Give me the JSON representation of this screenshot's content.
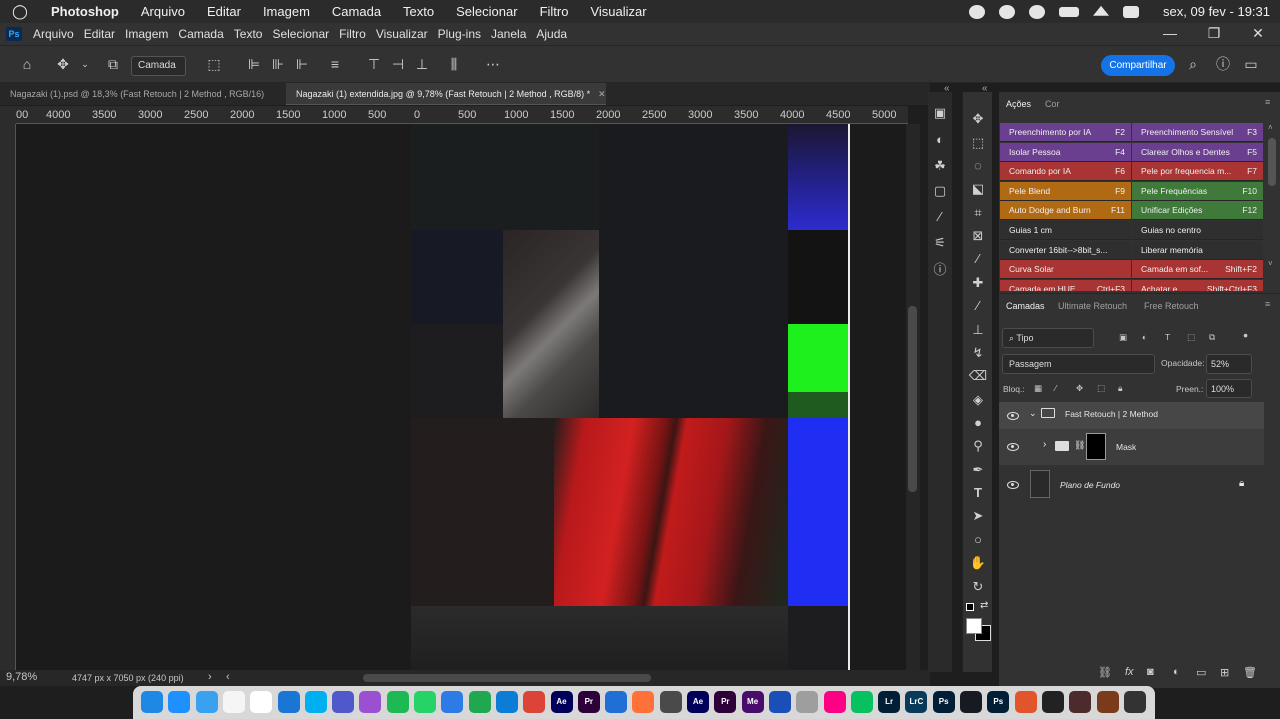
{
  "mac_menubar": {
    "app_name": "Photoshop",
    "items": [
      "Arquivo",
      "Editar",
      "Imagem",
      "Camada",
      "Texto",
      "Selecionar",
      "Filtro",
      "Visualizar"
    ],
    "clock": "sex, 09 fev - 19:31"
  },
  "ps_menubar": {
    "logo": "Ps",
    "items": [
      "Arquivo",
      "Editar",
      "Imagem",
      "Camada",
      "Texto",
      "Selecionar",
      "Filtro",
      "Visualizar",
      "Plug-ins",
      "Janela",
      "Ajuda"
    ],
    "window_controls": [
      "—",
      "❐",
      "✕"
    ]
  },
  "options_bar": {
    "target_select": "Camada",
    "share_button": "Compartilhar"
  },
  "tabs": [
    {
      "label": "Nagazaki (1).psd @ 18,3% (Fast Retouch | 2 Method , RGB/16) *",
      "active": false
    },
    {
      "label": "Nagazaki (1) extendida.jpg @ 9,78% (Fast Retouch | 2 Method , RGB/8) *",
      "active": true
    }
  ],
  "ruler_labels": [
    "00",
    "4000",
    "3500",
    "3000",
    "2500",
    "2000",
    "1500",
    "1000",
    "500",
    "0",
    "500",
    "1000",
    "1500",
    "2000",
    "2500",
    "3000",
    "3500",
    "4000",
    "4500",
    "5000"
  ],
  "status_bar": {
    "zoom": "9,78%",
    "dimensions": "4747 px x 7050 px (240 ppi)"
  },
  "actions_panel": {
    "tabs": [
      "Ações",
      "Cor"
    ],
    "rows": [
      {
        "left": "Preenchimento por IA",
        "left_key": "F2",
        "right": "Preenchimento Sensível",
        "right_key": "F3",
        "color": "#6a3f8f"
      },
      {
        "left": "Isolar Pessoa",
        "left_key": "F4",
        "right": "Clarear Olhos e Dentes",
        "right_key": "F5",
        "color": "#6a3f8f"
      },
      {
        "left": "Comando por IA",
        "left_key": "F6",
        "right": "Pele por frequencia m...",
        "right_key": "F7",
        "color": "#a83434"
      },
      {
        "left": "Pele Blend",
        "left_key": "F9",
        "right": "Pele Frequências",
        "right_key": "F10",
        "color": "#b06a14"
      },
      {
        "left": "Auto Dodge and Burn",
        "left_key": "F11",
        "right": "Unificar Edições",
        "right_key": "F12",
        "color": "#b06a14"
      },
      {
        "left": "Guias 1 cm",
        "left_key": "",
        "right": "Guias no centro",
        "right_key": "",
        "color": "#2f2f2f"
      },
      {
        "left": "Converter 16bit-->8bit_s...",
        "left_key": "",
        "right": "Liberar memória",
        "right_key": "",
        "color": "#2f2f2f"
      },
      {
        "left": "Curva Solar",
        "left_key": "",
        "right": "Camada em sof...",
        "right_key": "Shift+F2",
        "color": "#a83434"
      },
      {
        "left": "Camada em HUE",
        "left_key": "Ctrl+F3",
        "right": "Achatar e...",
        "right_key": "Shift+Ctrl+F3",
        "color": "#a83434"
      }
    ],
    "row5_right_color": "#3f7a3a",
    "row4_right_color": "#3f7a3a"
  },
  "layers_panel": {
    "tabs": [
      "Camadas",
      "Ultimate Retouch",
      "Free Retouch"
    ],
    "filter": "Tipo",
    "blend_mode": "Passagem",
    "opacity_label": "Opacidade:",
    "opacity_value": "52%",
    "lock_label": "Bloq.:",
    "fill_label": "Preen.:",
    "fill_value": "100%",
    "layers": [
      {
        "name": "Fast Retouch | 2 Method",
        "type": "group"
      },
      {
        "name": "Mask",
        "type": "group-child"
      },
      {
        "name": "Plano de Fundo",
        "type": "background"
      }
    ]
  },
  "colors": {
    "accent": "#1473e6",
    "canvas_red": "#c71a1a",
    "canvas_green": "#1ef01e",
    "canvas_blue": "#1f2ef2"
  },
  "dock": {
    "apps": [
      "Finder",
      "Safari",
      "iCloud",
      "Notes",
      "Calendar",
      "App Store",
      "Skype",
      "Teams",
      "Podcasts",
      "Spotify",
      "WhatsApp",
      "Files",
      "Numbers",
      "Edge",
      "Chrome",
      "Ae",
      "Pr",
      "Keynote",
      "Firefox",
      "Script",
      "Ae",
      "Pr",
      "Me",
      "Vectr",
      "Disk",
      "Flickr",
      "WeChat",
      "Lr",
      "LrC",
      "Ps",
      "Steam",
      "Ps",
      "Substance",
      "Unity",
      "Game1",
      "Game2",
      "Terminal"
    ]
  }
}
